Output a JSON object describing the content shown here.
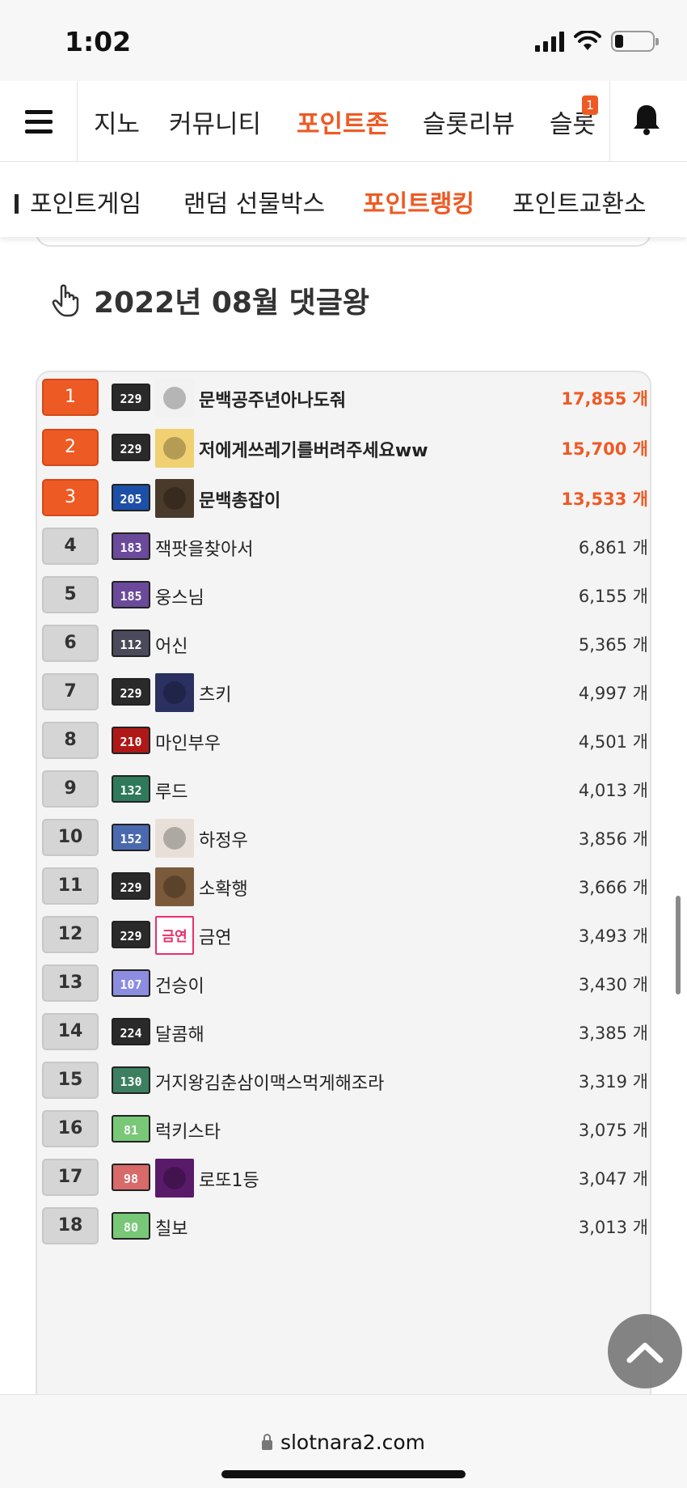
{
  "status_bar": {
    "time": "1:02"
  },
  "nav": {
    "tabs": [
      {
        "label": "지노",
        "active": false
      },
      {
        "label": "커뮤니티",
        "active": false
      },
      {
        "label": "포인트존",
        "active": true
      },
      {
        "label": "슬롯리뷰",
        "active": false
      },
      {
        "label": "슬롯",
        "active": false
      }
    ],
    "notification_count": "1",
    "accent_color": "#ee5a24"
  },
  "sub_nav": {
    "tabs": [
      {
        "label": "포인트게임",
        "active": false
      },
      {
        "label": "랜덤 선물박스",
        "active": false
      },
      {
        "label": "포인트랭킹",
        "active": true
      },
      {
        "label": "포인트교환소",
        "active": false
      }
    ]
  },
  "section": {
    "title": "2022년 08월 댓글왕"
  },
  "ranking": [
    {
      "rank": "1",
      "level": "229",
      "nickname": "문백공주년아나도줘",
      "count": "17,855 개",
      "has_avatar": true
    },
    {
      "rank": "2",
      "level": "229",
      "nickname": "저에게쓰레기를버려주세요ww",
      "count": "15,700 개",
      "has_avatar": true
    },
    {
      "rank": "3",
      "level": "205",
      "nickname": "문백총잡이",
      "count": "13,533 개",
      "has_avatar": true
    },
    {
      "rank": "4",
      "level": "183",
      "nickname": "잭팟을찾아서",
      "count": "6,861 개",
      "has_avatar": false
    },
    {
      "rank": "5",
      "level": "185",
      "nickname": "웅스님",
      "count": "6,155 개",
      "has_avatar": false
    },
    {
      "rank": "6",
      "level": "112",
      "nickname": "어신",
      "count": "5,365 개",
      "has_avatar": false
    },
    {
      "rank": "7",
      "level": "229",
      "nickname": "츠키",
      "count": "4,997 개",
      "has_avatar": true
    },
    {
      "rank": "8",
      "level": "210",
      "nickname": "마인부우",
      "count": "4,501 개",
      "has_avatar": false
    },
    {
      "rank": "9",
      "level": "132",
      "nickname": "루드",
      "count": "4,013 개",
      "has_avatar": false
    },
    {
      "rank": "10",
      "level": "152",
      "nickname": "하정우",
      "count": "3,856 개",
      "has_avatar": true
    },
    {
      "rank": "11",
      "level": "229",
      "nickname": "소확행",
      "count": "3,666 개",
      "has_avatar": true
    },
    {
      "rank": "12",
      "level": "229",
      "nickname": "금연",
      "count": "3,493 개",
      "has_avatar": true,
      "avatar_text": "금연"
    },
    {
      "rank": "13",
      "level": "107",
      "nickname": "건승이",
      "count": "3,430 개",
      "has_avatar": false
    },
    {
      "rank": "14",
      "level": "224",
      "nickname": "달콤해",
      "count": "3,385 개",
      "has_avatar": false
    },
    {
      "rank": "15",
      "level": "130",
      "nickname": "거지왕김춘삼이맥스먹게해조라",
      "count": "3,319 개",
      "has_avatar": false
    },
    {
      "rank": "16",
      "level": "81",
      "nickname": "럭키스타",
      "count": "3,075 개",
      "has_avatar": false
    },
    {
      "rank": "17",
      "level": "98",
      "nickname": "로또1등",
      "count": "3,047 개",
      "has_avatar": true
    },
    {
      "rank": "18",
      "level": "80",
      "nickname": "칠보",
      "count": "3,013 개",
      "has_avatar": false
    }
  ],
  "url_bar": {
    "url": "slotnara2.com"
  }
}
